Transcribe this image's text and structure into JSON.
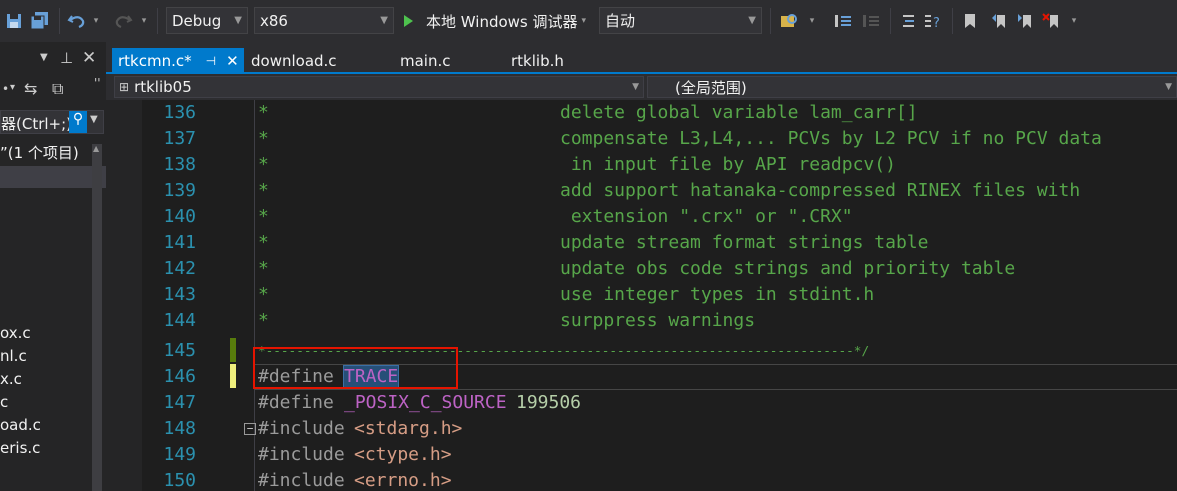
{
  "toolbar": {
    "config": "Debug",
    "platform": "x86",
    "run_label": "本地 Windows 调试器",
    "auto": "自动"
  },
  "leftpane": {
    "search_placeholder": "器(Ctrl+;)",
    "project_summary": "”(1 个项目)",
    "files": [
      "ox.c",
      "nl.c",
      "x.c",
      "c",
      "oad.c",
      "eris.c"
    ]
  },
  "tabs": [
    {
      "label": "rtkcmn.c*",
      "active": true
    },
    {
      "label": "download.c",
      "active": false
    },
    {
      "label": "main.c",
      "active": false
    },
    {
      "label": "rtklib.h",
      "active": false
    }
  ],
  "nav": {
    "project": "rtklib05",
    "scope": "(全局范围)"
  },
  "code_lines": [
    {
      "num": "136",
      "star": "*",
      "text": "delete global variable lam_carr[]"
    },
    {
      "num": "137",
      "star": "*",
      "text": "compensate L3,L4,... PCVs by L2 PCV if no PCV data"
    },
    {
      "num": "138",
      "star": "*",
      "text": " in input file by API readpcv()"
    },
    {
      "num": "139",
      "star": "*",
      "text": "add support hatanaka-compressed RINEX files with"
    },
    {
      "num": "140",
      "star": "*",
      "text": " extension \".crx\" or \".CRX\""
    },
    {
      "num": "141",
      "star": "*",
      "text": "update stream format strings table"
    },
    {
      "num": "142",
      "star": "*",
      "text": "update obs code strings and priority table"
    },
    {
      "num": "143",
      "star": "*",
      "text": "use integer types in stdint.h"
    },
    {
      "num": "144",
      "star": "*",
      "text": "surppress warnings"
    },
    {
      "num": "145",
      "text": "*-----------------------------------------------------------------------------*/"
    },
    {
      "num": "146",
      "directive": "#define",
      "macro": "TRACE"
    },
    {
      "num": "147",
      "directive": "#define",
      "macro": "_POSIX_C_SOURCE",
      "value": "199506"
    },
    {
      "num": "148",
      "directive": "#include",
      "header": "<stdarg.h>"
    },
    {
      "num": "149",
      "directive": "#include",
      "header": "<ctype.h>"
    },
    {
      "num": "150",
      "directive": "#include",
      "header": "<errno.h>"
    }
  ],
  "colors": {
    "comment": "#57a64a",
    "macro": "#bd63c5",
    "line_number": "#2b91af",
    "accent": "#007acc",
    "highlight_box": "#e51400"
  }
}
